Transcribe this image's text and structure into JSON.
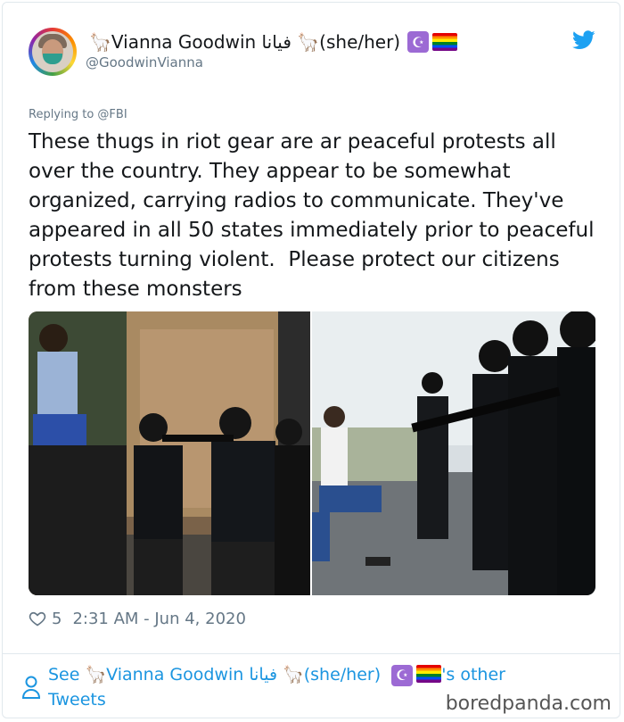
{
  "author": {
    "display_name": "🦙Vianna Goodwin فيانا 🦙(she/her)",
    "handle": "@GoodwinVianna"
  },
  "reply_to": "Replying to @FBI",
  "tweet_text": "These thugs in riot gear are ar peaceful protests all over the country. They appear to be somewhat organized, carrying radios to communicate. They've appeared in all 50 states immediately prior to peaceful protests turning violent.  Please protect our citizens from these monsters",
  "stats": {
    "likes": "5",
    "timestamp": "2:31 AM - Jun 4, 2020"
  },
  "footer": {
    "see_prefix": "See ",
    "name": "🦙Vianna Goodwin فيانا 🦙(she/her)",
    "suffix": "'s other",
    "line2": "Tweets"
  },
  "watermark": "boredpanda.com",
  "colors": {
    "link": "#1b95e0",
    "muted": "#657786",
    "twitter_blue": "#1da1f2"
  },
  "icons": [
    "twitter-bird-icon",
    "heart-icon",
    "person-icon",
    "star-and-crescent-icon",
    "rainbow-flag-icon"
  ]
}
